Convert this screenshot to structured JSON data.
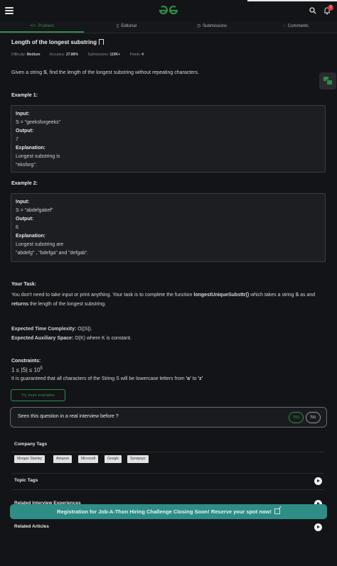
{
  "nav": {
    "tabs": [
      {
        "label": "Problem",
        "icon": "code-icon"
      },
      {
        "label": "Editorial",
        "icon": "document-icon"
      },
      {
        "label": "Submissions",
        "icon": "clock-icon"
      },
      {
        "label": "Comments",
        "icon": "comment-icon"
      }
    ],
    "bell_count": "7"
  },
  "problem": {
    "title": "Length of the longest substring",
    "difficulty_label": "Difficulty:",
    "difficulty": "Medium",
    "accuracy_label": "Accuracy:",
    "accuracy": "27.88%",
    "submissions_label": "Submissions:",
    "submissions": "119K+",
    "points_label": "Points:",
    "points": "4",
    "statement_pre": "Given a string ",
    "statement_s": "S",
    "statement_post": ", find the length of the longest substring without repeating characters."
  },
  "examples": [
    {
      "heading": "Example 1:",
      "input_label": "Input:",
      "input": "S = \"geeksforgeeks\"",
      "output_label": "Output:",
      "output": "7",
      "explanation_label": "Explanation:",
      "explanation_1": "Longest substring is",
      "explanation_2": "\"eksforg\"."
    },
    {
      "heading": "Example 2:",
      "input_label": "Input:",
      "input": "S = \"abdefgabef\"",
      "output_label": "Output:",
      "output": "6",
      "explanation_label": "Explanation:",
      "explanation_1": "Longest substring are",
      "explanation_2": "\"abdefg\" , \"bdefga\" and \"defgab\"."
    }
  ],
  "task": {
    "heading": "Your Task:",
    "line1_pre": "You don't need to take input or print anything. Your task is to complete the function ",
    "function_name": "longestUniqueSubsttr()",
    "line1_post": " which takes a string ",
    "line1_s": "S",
    "line1_end": " as and",
    "line2_bold": "returns",
    "line2_post": " the length of the longest substring."
  },
  "complexity": {
    "time_label": "Expected Time Complexity:",
    "time": "O(|S|).",
    "space_label": "Expected Auxiliary Space:",
    "space": "O(K) where K is constant."
  },
  "constraints": {
    "heading": "Constraints:",
    "range": "1 ≤ |S| ≤ 10",
    "exponent": "5",
    "note_pre": "It is guaranteed that all characters of the String S will be lowercase letters from ",
    "note_a": "'a'",
    "note_mid": " to ",
    "note_z": "'z'"
  },
  "actions": {
    "try_more": "Try more examples",
    "interview_question": "Seen this question in a real interview before ?",
    "yes": "Yes",
    "no": "No"
  },
  "sections": {
    "company_tags": "Company Tags",
    "companies": [
      "Morgan Stanley",
      "Amazon",
      "Microsoft",
      "Google",
      "Synopsys"
    ],
    "topic_tags": "Topic Tags",
    "related_experiences": "Related Interview Experiences",
    "related_articles": "Related Articles"
  },
  "banner": {
    "text": "Registration for Job-A-Thon Hiring Challenge Closing Soon! Reserve your spot now!"
  },
  "colors": {
    "background": "#131417",
    "accent_green": "#2f8d46",
    "banner_teal": "#2e8d86"
  }
}
